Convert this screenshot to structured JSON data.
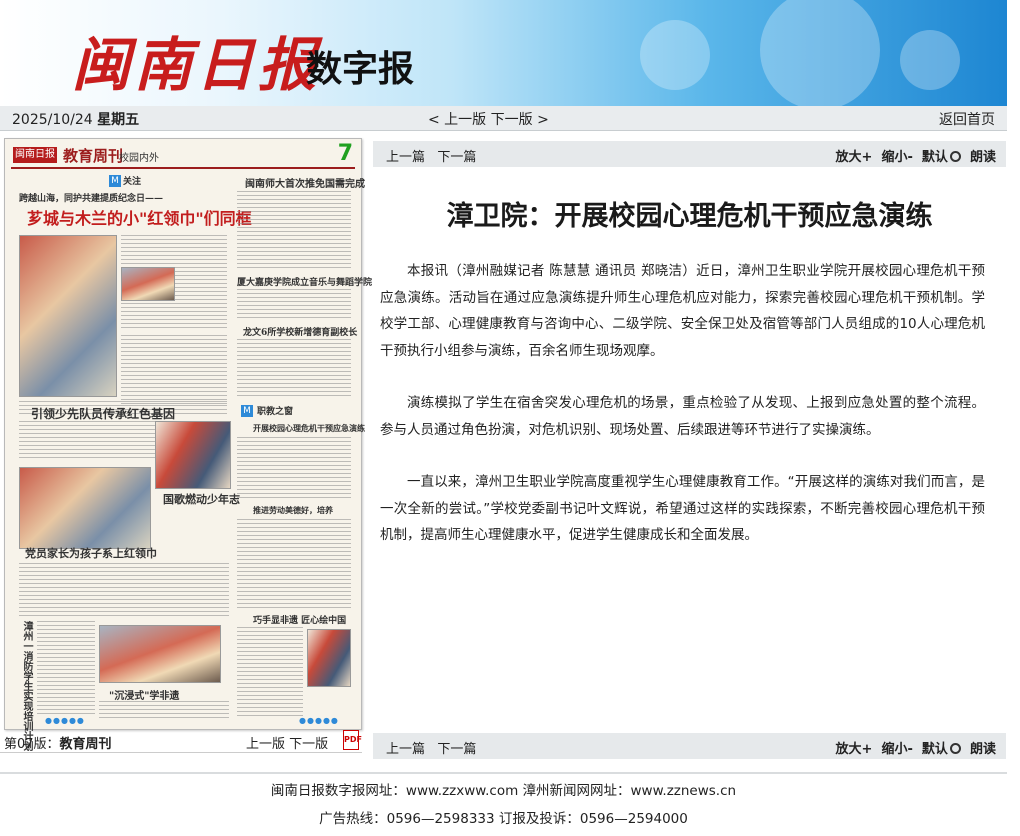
{
  "banner": {
    "brand": "闽南日报",
    "subtitle": "数字报"
  },
  "datebar": {
    "date": "2025/10/24",
    "weekday": "星期五",
    "prev_edition": "< 上一版",
    "next_edition": "下一版 >",
    "home": "返回首页"
  },
  "thumbnail": {
    "logo": "闽南日报",
    "title": "教育周刊",
    "section": "校园内外",
    "page_number": "7",
    "headlines": {
      "tag_focus": "关注",
      "kicker": "跨越山海，同护共建提质纪念日——",
      "main": "芗城与木兰的小\"红领巾\"们同框",
      "h2": "闽南师大首次推免国需完成",
      "h3": "厦大嘉庚学院成立音乐与舞蹈学院",
      "h4": "龙文6所学校新增德育副校长",
      "h5": "引领少先队员传承红色基因",
      "h6": "国歌燃动少年志",
      "h7": "党员家长为孩子系上红领巾",
      "h8": "漳州一消防学生实现培训计划",
      "h9": "巧手显非遗 匠心绘中国",
      "h10": "\"沉浸式\"学非遗",
      "tag_workplace": "职教之窗",
      "h11": "开展校园心理危机干预应急演练",
      "h12": "推进劳动美德好，培养"
    }
  },
  "pagebar": {
    "label": "第07版：",
    "name": "教育周刊",
    "prev_page": "上一版",
    "next_page": "下一版",
    "pdf": "PDF"
  },
  "toolbar": {
    "prev_article": "上一篇",
    "next_article": "下一篇",
    "zoom_in": "放大+",
    "zoom_out": "缩小-",
    "default": "默认",
    "read": "朗读"
  },
  "article": {
    "title": "漳卫院：开展校园心理危机干预应急演练",
    "paragraphs": [
      "本报讯（漳州融媒记者 陈慧慧 通讯员 郑晓洁）近日，漳州卫生职业学院开展校园心理危机干预应急演练。活动旨在通过应急演练提升师生心理危机应对能力，探索完善校园心理危机干预机制。学校学工部、心理健康教育与咨询中心、二级学院、安全保卫处及宿管等部门人员组成的10人心理危机干预执行小组参与演练，百余名师生现场观摩。",
      "演练模拟了学生在宿舍突发心理危机的场景，重点检验了从发现、上报到应急处置的整个流程。参与人员通过角色扮演，对危机识别、现场处置、后续跟进等环节进行了实操演练。",
      "一直以来，漳州卫生职业学院高度重视学生心理健康教育工作。“开展这样的演练对我们而言，是一次全新的尝试。”学校党委副书记叶文辉说，希望通过这样的实践探索，不断完善校园心理危机干预机制，提高师生心理健康水平，促进学生健康成长和全面发展。"
    ]
  },
  "footer": {
    "line1": "闽南日报数字报网址：www.zzxww.com 漳州新闻网网址：www.zznews.cn",
    "line2": "广告热线：0596—2598333 订报及投诉：0596—2594000"
  }
}
